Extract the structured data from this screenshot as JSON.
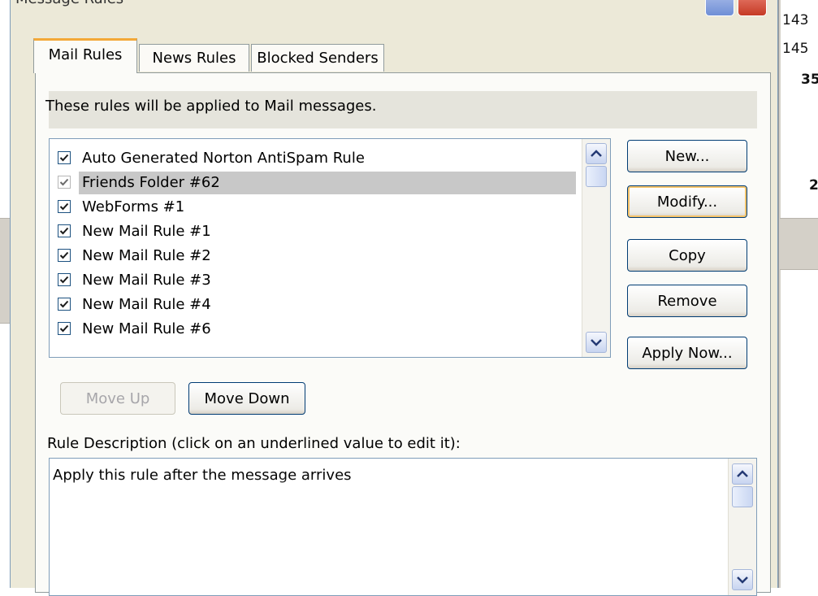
{
  "background": {
    "right_numbers": [
      "143",
      "145",
      "35",
      "2"
    ]
  },
  "dialog": {
    "title": "Message Rules",
    "tabs": [
      {
        "label": "Mail Rules",
        "active": true
      },
      {
        "label": "News Rules",
        "active": false
      },
      {
        "label": "Blocked Senders",
        "active": false
      }
    ],
    "header_text": "These rules will be applied to Mail messages.",
    "rules": [
      {
        "label": "Auto Generated Norton AntiSpam Rule",
        "checked": true,
        "selected": false
      },
      {
        "label": "Friends Folder #62",
        "checked": true,
        "selected": true
      },
      {
        "label": "WebForms #1",
        "checked": true,
        "selected": false
      },
      {
        "label": "New Mail Rule #1",
        "checked": true,
        "selected": false
      },
      {
        "label": "New Mail Rule #2",
        "checked": true,
        "selected": false
      },
      {
        "label": "New Mail Rule #3",
        "checked": true,
        "selected": false
      },
      {
        "label": "New Mail Rule #4",
        "checked": true,
        "selected": false
      },
      {
        "label": "New Mail Rule #6",
        "checked": true,
        "selected": false
      }
    ],
    "buttons": {
      "new": "New...",
      "modify": "Modify...",
      "copy": "Copy",
      "remove": "Remove",
      "apply_now": "Apply Now...",
      "move_up": "Move Up",
      "move_down": "Move Down"
    },
    "description_label": "Rule Description (click on an underlined value to edit it):",
    "description_lines": [
      "Apply this rule after the message arrives"
    ]
  },
  "colors": {
    "accent_tab": "#f3a838",
    "selection": "#c8c8c8",
    "button_border": "#003c74"
  }
}
